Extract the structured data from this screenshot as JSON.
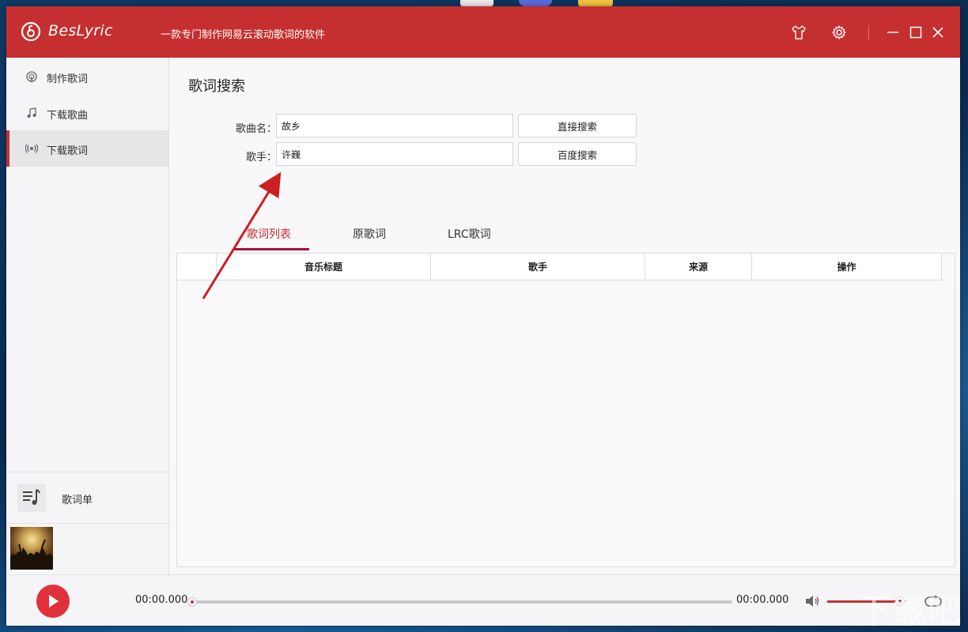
{
  "titlebar": {
    "app_name": "BesLyric",
    "slogan": "一款专门制作网易云滚动歌词的软件"
  },
  "sidebar": {
    "items": [
      {
        "label": "制作歌词",
        "icon": "podcast-icon"
      },
      {
        "label": "下载歌曲",
        "icon": "music-note-icon"
      },
      {
        "label": "下载歌词",
        "icon": "radio-icon"
      }
    ],
    "active_index": 2,
    "playlist_label": "歌词单"
  },
  "main": {
    "title": "歌词搜索",
    "form": {
      "song_label": "歌曲名：",
      "song_value": "故乡",
      "artist_label": "歌手：",
      "artist_value": "许巍",
      "direct_search_label": "直接搜索",
      "baidu_search_label": "百度搜索"
    },
    "tabs": [
      {
        "label": "歌词列表"
      },
      {
        "label": "原歌词"
      },
      {
        "label": "LRC歌词"
      }
    ],
    "active_tab": 0,
    "table": {
      "columns": [
        "",
        "音乐标题",
        "歌手",
        "来源",
        "操作"
      ],
      "rows": []
    }
  },
  "player": {
    "current_time": "00:00.000",
    "total_time": "00:00.000",
    "progress": 0,
    "volume": 0.92
  },
  "colors": {
    "brand": "#c62f2f",
    "play_button": "#e0313a",
    "tab_active_underline": "#a4123a",
    "annotation_arrow": "#cc1f1f"
  },
  "watermark": "下载吧"
}
